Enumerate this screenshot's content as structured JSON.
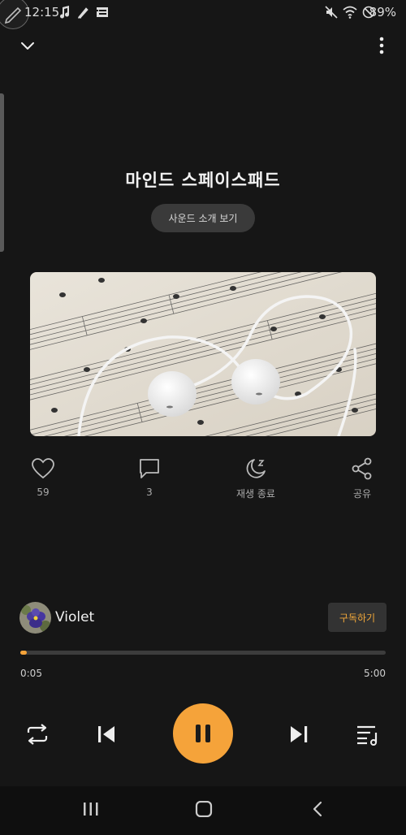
{
  "status_bar": {
    "time": "12:15",
    "battery": "89%",
    "icons": [
      "music-note-icon",
      "pen-notification-icon",
      "app-notification-icon",
      "mute-icon",
      "wifi-icon",
      "do-not-disturb-icon"
    ]
  },
  "header": {
    "title": "마인드 스페이스패드",
    "intro_button": "사운드 소개 보기"
  },
  "actions": {
    "like_count": "59",
    "comment_count": "3",
    "sleep_timer_label": "재생 종료",
    "share_label": "공유"
  },
  "artist": {
    "name": "Violet",
    "subscribe_label": "구독하기"
  },
  "player": {
    "elapsed": "0:05",
    "total": "5:00",
    "progress": 0.017,
    "state": "playing"
  },
  "colors": {
    "accent": "#f5a33a",
    "background": "#161616"
  }
}
